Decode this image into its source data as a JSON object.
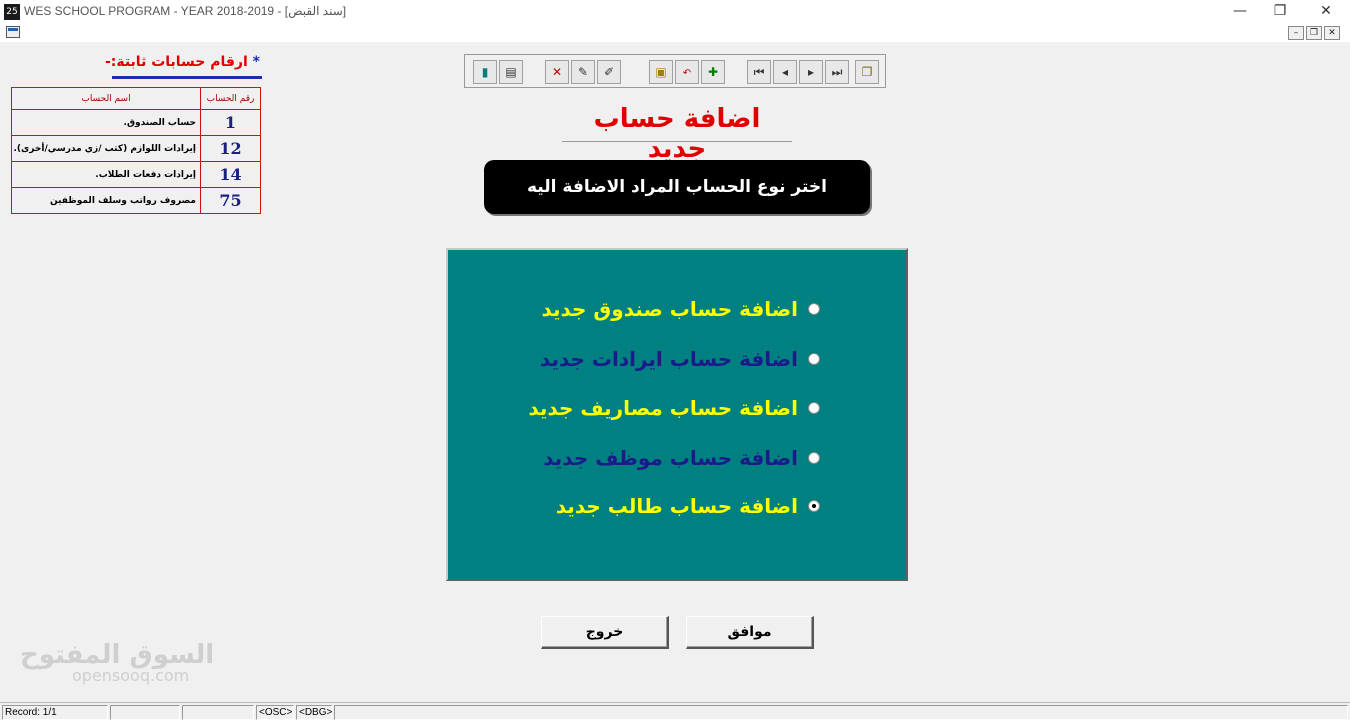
{
  "window": {
    "title": "WES SCHOOL PROGRAM - YEAR 2018-2019 - [سند القبض]",
    "app_icon": "app-icon",
    "controls": [
      "minimize-icon",
      "restore-icon",
      "close-icon"
    ]
  },
  "fixed_accounts": {
    "heading_star": "*",
    "heading": "ارقام حسابات ثابتة:-",
    "col_number": "رقم الحساب",
    "col_name": "اسم الحساب",
    "rows": [
      {
        "number": "1",
        "name": "حساب الصندوق."
      },
      {
        "number": "12",
        "name": "إيرادات اللوازم (كتب /زي مدرسي/أخرى)."
      },
      {
        "number": "14",
        "name": "إيرادات دفعات الطلاب."
      },
      {
        "number": "75",
        "name": "مصروف رواتب وسلف الموظفين"
      }
    ]
  },
  "toolbar": {
    "buttons": [
      "exit-door-icon",
      "print-icon",
      "delete-icon",
      "edit-icon",
      "edit-tools-icon",
      "save-icon",
      "cancel-icon",
      "new-record-icon",
      "first-record-icon",
      "previous-record-icon",
      "next-record-icon",
      "last-record-icon",
      "copy-icon"
    ]
  },
  "main": {
    "title": "اضافة حساب جديد",
    "prompt": "اختر نوع الحساب المراد الاضافة اليه",
    "options": [
      {
        "label": "اضافة حساب صندوق جديد",
        "color": "#ffff00",
        "checked": false
      },
      {
        "label": "اضافة حساب ايرادات جديد",
        "color": "#1a1a8a",
        "checked": false
      },
      {
        "label": "اضافة حساب مصاريف جديد",
        "color": "#ffff00",
        "checked": false
      },
      {
        "label": "اضافة حساب موظف جديد",
        "color": "#1a1a8a",
        "checked": false
      },
      {
        "label": "اضافة حساب طالب جديد",
        "color": "#ffff00",
        "checked": true
      }
    ],
    "ok_label": "موافق",
    "exit_label": "خروج"
  },
  "watermark": {
    "arabic": "السوق المفتوح",
    "latin": "opensooq.com"
  },
  "statusbar": {
    "record": "Record: 1/1",
    "osc": "<OSC>",
    "dbg": "<DBG>"
  },
  "colors": {
    "panel": "#008080",
    "title_red": "#e00000",
    "option_yellow": "#ffff00",
    "option_blue": "#1a1a8a"
  }
}
